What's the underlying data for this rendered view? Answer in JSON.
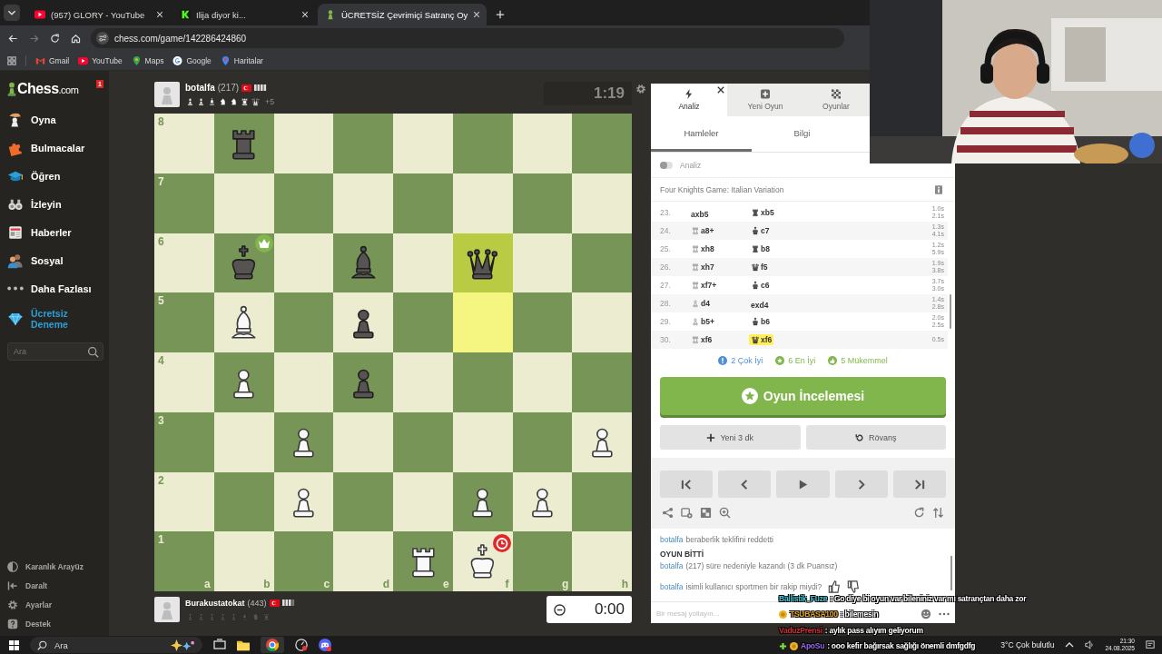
{
  "browser": {
    "tabs": [
      {
        "title": "(957) GLORY - YouTube",
        "selected": false
      },
      {
        "title": "Ilija diyor ki...",
        "selected": false
      },
      {
        "title": "ÜCRETSİZ Çevrimiçi Satranç Oy",
        "selected": true
      }
    ],
    "url": "chess.com/game/142286424860",
    "bookmarks": [
      "Gmail",
      "YouTube",
      "Maps",
      "Google",
      "Haritalar"
    ]
  },
  "sidebar": {
    "logo_name": "Chess",
    "logo_suffix": ".com",
    "notification_count": "1",
    "items": [
      {
        "label": "Oyna",
        "kind": "nav"
      },
      {
        "label": "Bulmacalar",
        "kind": "nav"
      },
      {
        "label": "Öğren",
        "kind": "nav"
      },
      {
        "label": "İzleyin",
        "kind": "nav"
      },
      {
        "label": "Haberler",
        "kind": "nav"
      },
      {
        "label": "Sosyal",
        "kind": "nav"
      },
      {
        "label": "Daha Fazlası",
        "kind": "nav"
      },
      {
        "label": "Ücretsiz Deneme",
        "kind": "premium"
      }
    ],
    "search": {
      "placeholder": "Ara"
    },
    "footer_items": [
      "Karanlık Arayüz",
      "Daralt",
      "Ayarlar",
      "Destek"
    ]
  },
  "top_player": {
    "name": "botalfa",
    "rating": "(217)",
    "captured": [
      {
        "kind": "white_pawn"
      },
      {
        "kind": "white_pawn"
      },
      {
        "kind": "white_bishop"
      },
      {
        "kind": "white_knight"
      },
      {
        "kind": "white_knight"
      },
      {
        "kind": "white_rook"
      },
      {
        "kind": "white_queen"
      }
    ],
    "advantage": "+5",
    "clock": "1:19",
    "clock_active": false
  },
  "bottom_player": {
    "name": "Burakustatokat",
    "rating": "(443)",
    "captured": [
      {
        "kind": "black_pawn"
      },
      {
        "kind": "black_pawn"
      },
      {
        "kind": "black_pawn"
      },
      {
        "kind": "black_pawn"
      },
      {
        "kind": "black_pawn"
      },
      {
        "kind": "black_bishop"
      },
      {
        "kind": "black_knight"
      },
      {
        "kind": "black_rook"
      }
    ],
    "clock": "0:00",
    "clock_active": true
  },
  "board": {
    "files": [
      "a",
      "b",
      "c",
      "d",
      "e",
      "f",
      "g",
      "h"
    ],
    "ranks": [
      {
        "label": "8",
        "squares": [
          {
            "kind": "empty",
            "highlighted": false
          },
          {
            "kind": "black_rook",
            "highlighted": false
          },
          {
            "kind": "empty",
            "highlighted": false
          },
          {
            "kind": "empty",
            "highlighted": false
          },
          {
            "kind": "empty",
            "highlighted": false
          },
          {
            "kind": "empty",
            "highlighted": false
          },
          {
            "kind": "empty",
            "highlighted": false
          },
          {
            "kind": "empty",
            "highlighted": false
          }
        ]
      },
      {
        "label": "7",
        "squares": [
          {
            "kind": "empty",
            "highlighted": false
          },
          {
            "kind": "empty",
            "highlighted": false
          },
          {
            "kind": "empty",
            "highlighted": false
          },
          {
            "kind": "empty",
            "highlighted": false
          },
          {
            "kind": "empty",
            "highlighted": false
          },
          {
            "kind": "empty",
            "highlighted": false
          },
          {
            "kind": "empty",
            "highlighted": false
          },
          {
            "kind": "empty",
            "highlighted": false
          }
        ]
      },
      {
        "label": "6",
        "squares": [
          {
            "kind": "empty",
            "highlighted": false
          },
          {
            "kind": "black_king",
            "highlighted": false,
            "badge": {
              "kind": "winner"
            }
          },
          {
            "kind": "empty",
            "highlighted": false
          },
          {
            "kind": "black_bishop",
            "highlighted": false
          },
          {
            "kind": "empty",
            "highlighted": false
          },
          {
            "kind": "black_queen",
            "highlighted": true
          },
          {
            "kind": "empty",
            "highlighted": false
          },
          {
            "kind": "empty",
            "highlighted": false
          }
        ]
      },
      {
        "label": "5",
        "squares": [
          {
            "kind": "empty",
            "highlighted": false
          },
          {
            "kind": "white_bishop",
            "highlighted": false
          },
          {
            "kind": "empty",
            "highlighted": false
          },
          {
            "kind": "black_pawn",
            "highlighted": false
          },
          {
            "kind": "empty",
            "highlighted": false
          },
          {
            "kind": "empty",
            "highlighted": true
          },
          {
            "kind": "empty",
            "highlighted": false
          },
          {
            "kind": "empty",
            "highlighted": false
          }
        ]
      },
      {
        "label": "4",
        "squares": [
          {
            "kind": "empty",
            "highlighted": false
          },
          {
            "kind": "white_pawn",
            "highlighted": false
          },
          {
            "kind": "empty",
            "highlighted": false
          },
          {
            "kind": "black_pawn",
            "highlighted": false
          },
          {
            "kind": "empty",
            "highlighted": false
          },
          {
            "kind": "empty",
            "highlighted": false
          },
          {
            "kind": "empty",
            "highlighted": false
          },
          {
            "kind": "empty",
            "highlighted": false
          }
        ]
      },
      {
        "label": "3",
        "squares": [
          {
            "kind": "empty",
            "highlighted": false
          },
          {
            "kind": "empty",
            "highlighted": false
          },
          {
            "kind": "white_pawn",
            "highlighted": false
          },
          {
            "kind": "empty",
            "highlighted": false
          },
          {
            "kind": "empty",
            "highlighted": false
          },
          {
            "kind": "empty",
            "highlighted": false
          },
          {
            "kind": "empty",
            "highlighted": false
          },
          {
            "kind": "white_pawn",
            "highlighted": false
          }
        ]
      },
      {
        "label": "2",
        "squares": [
          {
            "kind": "empty",
            "highlighted": false
          },
          {
            "kind": "empty",
            "highlighted": false
          },
          {
            "kind": "white_pawn",
            "highlighted": false
          },
          {
            "kind": "empty",
            "highlighted": false
          },
          {
            "kind": "empty",
            "highlighted": false
          },
          {
            "kind": "white_pawn",
            "highlighted": false
          },
          {
            "kind": "white_pawn",
            "highlighted": false
          },
          {
            "kind": "empty",
            "highlighted": false
          }
        ]
      },
      {
        "label": "1",
        "squares": [
          {
            "kind": "empty",
            "highlighted": false
          },
          {
            "kind": "empty",
            "highlighted": false
          },
          {
            "kind": "empty",
            "highlighted": false
          },
          {
            "kind": "empty",
            "highlighted": false
          },
          {
            "kind": "white_rook",
            "highlighted": false
          },
          {
            "kind": "white_king",
            "highlighted": false,
            "badge": {
              "kind": "timeout"
            }
          },
          {
            "kind": "empty",
            "highlighted": false
          },
          {
            "kind": "empty",
            "highlighted": false
          }
        ]
      }
    ]
  },
  "panel": {
    "tabs": [
      {
        "label": "Analiz",
        "selected": true
      },
      {
        "label": "Yeni Oyun",
        "selected": false
      },
      {
        "label": "Oyunlar",
        "selected": false
      }
    ],
    "subtabs": [
      {
        "label": "Hamleler",
        "selected": true
      },
      {
        "label": "Bilgi",
        "selected": false
      }
    ],
    "analysis": {
      "label": "Analiz",
      "on": false
    },
    "opening": "Four Knights Game: Italian Variation",
    "moves": [
      {
        "number": "23.",
        "white": "axb5",
        "black_figure": {
          "kind": "rook"
        },
        "black": "xb5",
        "white_time": "1.0s",
        "black_time": "2.1s",
        "white_selected": false,
        "black_selected": false
      },
      {
        "number": "24.",
        "white_figure": {
          "kind": "rook"
        },
        "white": "a8+",
        "black_figure": {
          "kind": "king"
        },
        "black": "c7",
        "white_time": "1.3s",
        "black_time": "4.1s",
        "white_selected": false,
        "black_selected": false
      },
      {
        "number": "25.",
        "white_figure": {
          "kind": "rook"
        },
        "white": "xh8",
        "black_figure": {
          "kind": "rook"
        },
        "black": "b8",
        "white_time": "1.2s",
        "black_time": "5.9s",
        "white_selected": false,
        "black_selected": false
      },
      {
        "number": "26.",
        "white_figure": {
          "kind": "rook"
        },
        "white": "xh7",
        "black_figure": {
          "kind": "queen"
        },
        "black": "f5",
        "white_time": "1.9s",
        "black_time": "3.8s",
        "white_selected": false,
        "black_selected": false
      },
      {
        "number": "27.",
        "white_figure": {
          "kind": "rook"
        },
        "white": "xf7+",
        "black_figure": {
          "kind": "king"
        },
        "black": "c6",
        "white_time": "3.7s",
        "black_time": "3.0s",
        "white_selected": false,
        "black_selected": false
      },
      {
        "number": "28.",
        "white_figure": {
          "kind": "pawn"
        },
        "white": "d4",
        "black": "exd4",
        "white_time": "1.4s",
        "black_time": "2.8s",
        "white_selected": false,
        "black_selected": false
      },
      {
        "number": "29.",
        "white_figure": {
          "kind": "pawn"
        },
        "white": "b5+",
        "black_figure": {
          "kind": "king"
        },
        "black": "b6",
        "white_time": "2.0s",
        "black_time": "2.5s",
        "white_selected": false,
        "black_selected": false
      },
      {
        "number": "30.",
        "white_figure": {
          "kind": "rook"
        },
        "white": "xf6",
        "black_figure": {
          "kind": "queen"
        },
        "black": "xf6",
        "white_time": "0.5s",
        "white_selected": false,
        "black_selected": true
      }
    ],
    "summary": [
      {
        "label": "2 Çok İyi",
        "kind": "great",
        "color": "#4f8fd6"
      },
      {
        "label": "6 En İyi",
        "kind": "best",
        "color": "#81b64c"
      },
      {
        "label": "5 Mükemmel",
        "kind": "excellent",
        "color": "#81b64c"
      }
    ],
    "review_button": "Oyun İncelemesi",
    "new_game_button": "Yeni 3 dk",
    "rematch_button": "Rövanş",
    "chat": [
      {
        "kind": "user",
        "user": "botalfa",
        "text": "beraberlik teklifini reddetti"
      },
      {
        "kind": "heading",
        "text": "OYUN BİTTİ"
      },
      {
        "kind": "user",
        "user": "botalfa",
        "text": "(217) süre nedeniyle kazandı (3 dk Puansız)"
      },
      {
        "kind": "prompt",
        "user": "botalfa",
        "text": "isimli kullanıcı sportmen bir rakip miydi?"
      }
    ],
    "chat_placeholder": "Bir mesaj yollayın..."
  },
  "stream_chat": [
    {
      "kind": "plain",
      "user": "Ballistik_Fuze",
      "text": ": Go diye bi oyun var bileniniz var mı satrançtan daha zor",
      "color": "#3fc7d8"
    },
    {
      "kind": "coin",
      "user": "TSUBASA100",
      "text": ": bilemesin",
      "color": "#e8a51c"
    },
    {
      "kind": "plain",
      "user": "VaduzPrensi",
      "text": ": aylık pass alıyım geliyorum",
      "color": "#d8303a"
    },
    {
      "kind": "plus",
      "user": "ApoSu",
      "text": ": ooo kefir bağırsak sağlığı önemli dmfgdfg",
      "color": "#9b6cf0"
    }
  ],
  "taskbar": {
    "search": "Ara",
    "weather": "3°C Çok bulutlu",
    "time": "21:30",
    "date": "24.08.2025"
  }
}
